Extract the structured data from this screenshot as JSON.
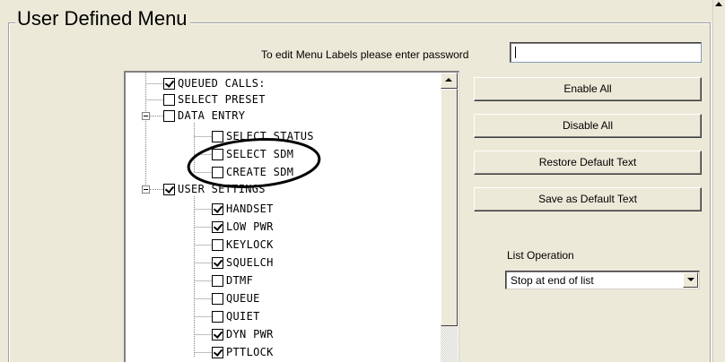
{
  "group": {
    "title": "User Defined Menu"
  },
  "password": {
    "label": "To edit Menu Labels please enter password",
    "value": ""
  },
  "tree": {
    "items": [
      {
        "label": "QUEUED CALLS:",
        "checked": true,
        "level": 0
      },
      {
        "label": "SELECT PRESET",
        "checked": false,
        "level": 0
      },
      {
        "label": "DATA ENTRY",
        "checked": false,
        "level": 0,
        "expanded": true
      },
      {
        "label": "SELECT STATUS",
        "checked": false,
        "level": 1
      },
      {
        "label": "SELECT SDM",
        "checked": false,
        "level": 1
      },
      {
        "label": "CREATE SDM",
        "checked": false,
        "level": 1
      },
      {
        "label": "USER SETTINGS",
        "checked": true,
        "level": 0,
        "expanded": true
      },
      {
        "label": "HANDSET",
        "checked": true,
        "level": 1
      },
      {
        "label": "LOW PWR",
        "checked": true,
        "level": 1
      },
      {
        "label": "KEYLOCK",
        "checked": false,
        "level": 1
      },
      {
        "label": "SQUELCH",
        "checked": true,
        "level": 1
      },
      {
        "label": "DTMF",
        "checked": false,
        "level": 1
      },
      {
        "label": "QUEUE",
        "checked": false,
        "level": 1
      },
      {
        "label": "QUIET",
        "checked": false,
        "level": 1
      },
      {
        "label": "DYN PWR",
        "checked": true,
        "level": 1
      },
      {
        "label": "PTTLOCK",
        "checked": true,
        "level": 1
      }
    ]
  },
  "buttons": {
    "enable_all": "Enable All",
    "disable_all": "Disable All",
    "restore_default": "Restore Default Text",
    "save_default": "Save as Default Text"
  },
  "list_operation": {
    "label": "List Operation",
    "selected": "Stop at end of list"
  }
}
